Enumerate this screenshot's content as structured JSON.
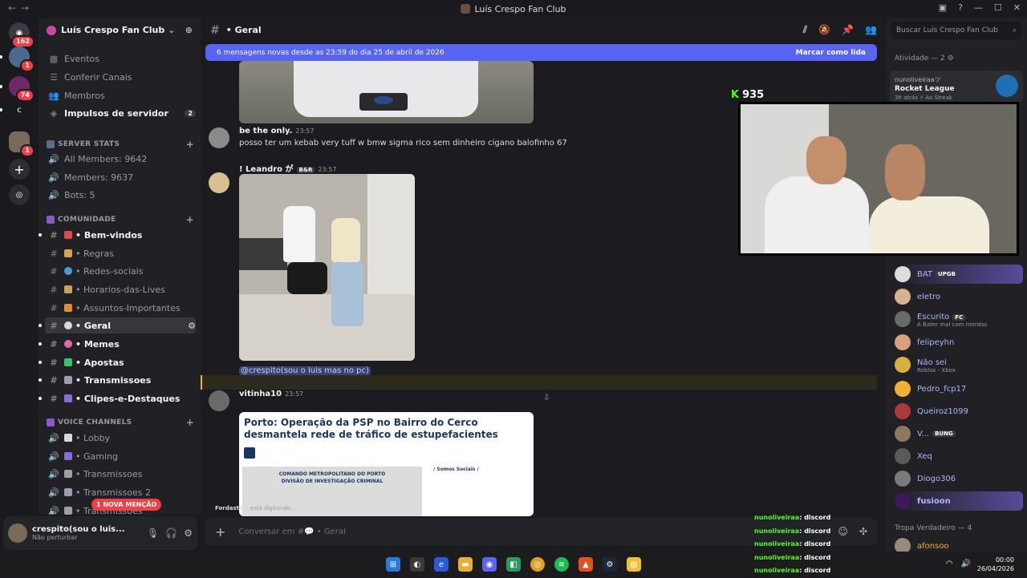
{
  "window": {
    "title": "Luís Crespo Fan Club"
  },
  "rail": {
    "home_badge": "162",
    "servers": [
      {
        "badge": "1"
      },
      {
        "badge": "74"
      },
      {
        "label": "c"
      },
      {
        "badge": "1"
      }
    ]
  },
  "guild": {
    "name": "Luís Crespo Fan Club"
  },
  "sidebar": {
    "top_items": [
      "Eventos",
      "Conferir Canais",
      "Membros",
      "Impulsos de servidor"
    ],
    "boost_count": "2",
    "stats_category": "SERVER STATS",
    "stats": [
      "All Members: 9642",
      "Members: 9637",
      "Bots: 5"
    ],
    "community_category": "COMUNIDADE",
    "channels": [
      "• Bem-vindos",
      "• Regras",
      "• Redes-sociais",
      "• Horarios-das-Lives",
      "• Assuntos-Importantes",
      "• Geral",
      "• Memes",
      "• Apostas",
      "• Transmissoes",
      "• Clipes-e-Destaques"
    ],
    "voice_category": "VOICE CHANNELS",
    "voice": [
      "• Lobby",
      "• Gaming",
      "• Transmissoes",
      "• Transmissoes 2",
      "• Transmissoes"
    ],
    "mention_pill": "1 NOVA MENÇÃO"
  },
  "user": {
    "name": "crespito(sou o luis...",
    "status": "Não perturbar"
  },
  "channel": {
    "name": "• Geral"
  },
  "new_messages": {
    "text": "6 mensagens novas desde as 23:59 do dia 25 de abril de 2026",
    "action": "Marcar como lida"
  },
  "messages": [
    {
      "author": "be the only.",
      "time": "23:57",
      "text": "posso ter um kebab very tuff w bmw sigma rico sem dinheiro cigano balofinho 67"
    },
    {
      "author": "! Leandro が",
      "tag": "B&R",
      "time": "23:57",
      "mention": "@crespito(sou o luis mas no pc)"
    },
    {
      "author": "vitinha10",
      "time": "23:57"
    }
  ],
  "article": {
    "title": "Porto: Operação da PSP no Bairro do Cerco desmantela rede de tráfico de estupefacientes",
    "banner_line1": "COMANDO METROPOLITANO DO PORTO",
    "banner_line2": "DIVISÃO DE INVESTIGAÇÃO CRIMINAL",
    "side_title": "/ Somos Sociais /"
  },
  "typing": {
    "user": "Fordastiko",
    "suffix": " está digitando..."
  },
  "composer": {
    "placeholder": "Conversar em #💬 • Geral"
  },
  "members": {
    "search_placeholder": "Buscar Luís Crespo Fan Club",
    "activity_header": "Atividade — 2",
    "activity": {
      "name": "nunoliveiraaツ",
      "game": "Rocket League",
      "sub": "3h atrás  ⚡ Ao Streak"
    },
    "list": [
      {
        "name": "BAT",
        "tag": "UPGB"
      },
      {
        "name": "eletro"
      },
      {
        "name": "Escurito",
        "tag": "FC",
        "sub": "A Bater mal com merdas"
      },
      {
        "name": "felipeyhn"
      },
      {
        "name": "Não sei",
        "sub": "Roblox - Xbox"
      },
      {
        "name": "Pedro_fcp17"
      },
      {
        "name": "Queiroz1099"
      },
      {
        "name": "V...",
        "tag": "BUNG"
      },
      {
        "name": "Xeq"
      },
      {
        "name": "Diogo306"
      },
      {
        "name": "fusioon"
      }
    ],
    "tropa_header": "Tropa Verdadeiro — 4",
    "tropa_first": "afonsoo"
  },
  "stream": {
    "viewers": "935",
    "chat_user": "nunoliveiraa",
    "chat_msg": ": discord"
  },
  "clock": {
    "time": "00:00",
    "date": "26/04/2026"
  }
}
